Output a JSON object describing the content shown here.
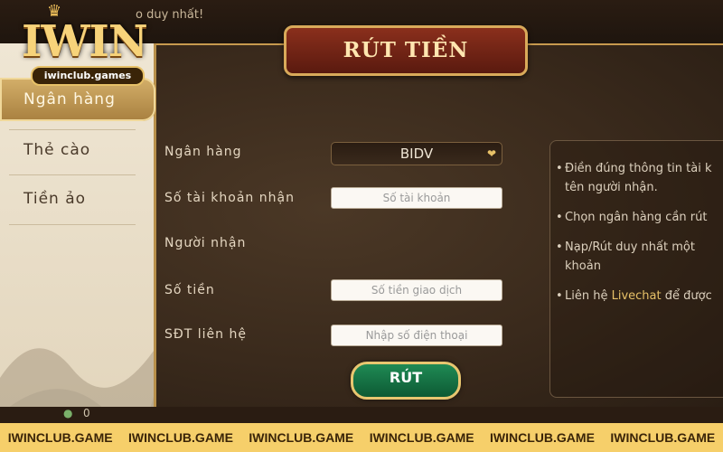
{
  "top": {
    "marquee": "o duy nhất!"
  },
  "logo": {
    "brand": "IWIN",
    "domain": "iwinclub.games"
  },
  "dialog": {
    "title": "RÚT TIỀN"
  },
  "sidebar": {
    "items": [
      {
        "label": "Ngân hàng",
        "active": true
      },
      {
        "label": "Thẻ cào",
        "active": false
      },
      {
        "label": "Tiền ảo",
        "active": false
      }
    ]
  },
  "form": {
    "bank": {
      "label": "Ngân hàng",
      "value": "BIDV"
    },
    "account": {
      "label": "Số tài khoản nhận",
      "placeholder": "Số tài khoản"
    },
    "receiver": {
      "label": "Người nhận"
    },
    "amount": {
      "label": "Số tiền",
      "placeholder": "Số tiền giao dịch"
    },
    "phone": {
      "label": "SĐT liên hệ",
      "placeholder": "Nhập số điện thoại"
    },
    "submit_label": "RÚT"
  },
  "info": {
    "items": [
      "Điền đúng thông tin tài k",
      "tên người nhận.",
      "Chọn ngân hàng cần rút",
      "Nạp/Rút duy nhất một",
      "khoản",
      "Liên hệ",
      "Livechat",
      "để được"
    ]
  },
  "bottom": {
    "count": "0"
  },
  "footer": {
    "labels": [
      "IWINCLUB.GAME",
      "IWINCLUB.GAME",
      "IWINCLUB.GAME",
      "IWINCLUB.GAME",
      "IWINCLUB.GAME",
      "IWINCLUB.GAME"
    ]
  }
}
